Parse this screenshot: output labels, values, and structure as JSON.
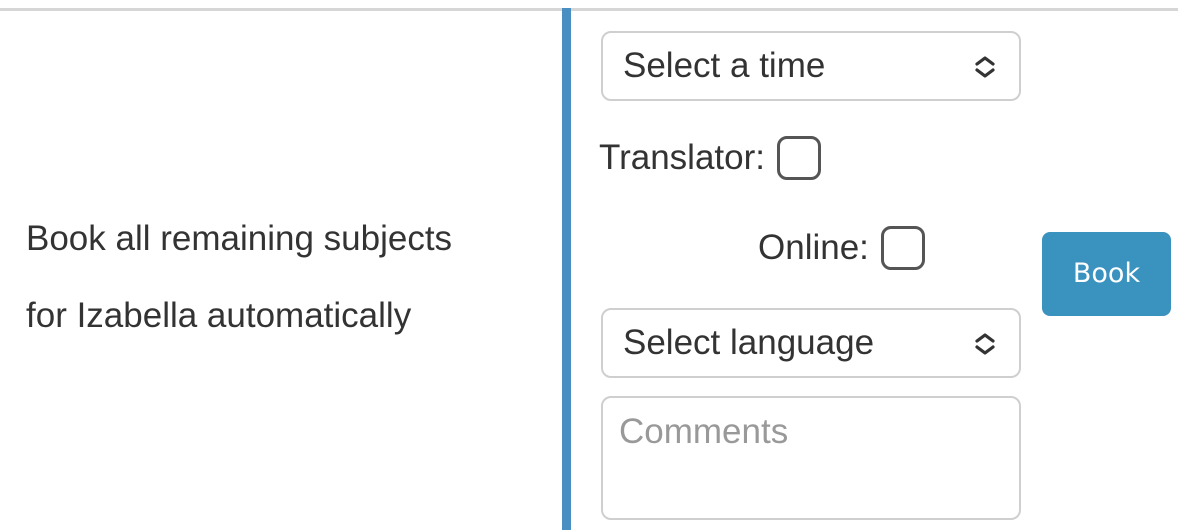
{
  "description": {
    "line1": "Book all remaining subjects",
    "line2": "for Izabella automatically"
  },
  "form": {
    "time_select": {
      "value": "Select a time",
      "icon": "chevron-up-down-icon"
    },
    "translator": {
      "label": "Translator:",
      "checked": false
    },
    "online": {
      "label": "Online:",
      "checked": false
    },
    "language_select": {
      "value": "Select language",
      "icon": "chevron-up-down-icon"
    },
    "comments": {
      "placeholder": "Comments",
      "value": ""
    },
    "book_button": {
      "label": "Book"
    }
  },
  "colors": {
    "accent": "#3a92bf",
    "divider": "#4a8fc2",
    "text": "#333333",
    "placeholder": "#999999",
    "border": "#cfcfcf"
  }
}
